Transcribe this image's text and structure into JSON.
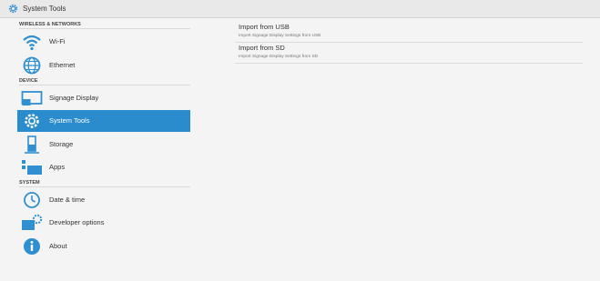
{
  "window": {
    "title": "System Tools",
    "title_icon": "gear-icon"
  },
  "sidebar": {
    "sections": [
      {
        "header": "WIRELESS & NETWORKS",
        "items": [
          {
            "label": "Wi-Fi",
            "icon": "wifi-icon"
          },
          {
            "label": "Ethernet",
            "icon": "ethernet-icon"
          }
        ]
      },
      {
        "header": "DEVICE",
        "items": [
          {
            "label": "Signage Display",
            "icon": "display-icon"
          },
          {
            "label": "System Tools",
            "icon": "gear-icon",
            "selected": true
          },
          {
            "label": "Storage",
            "icon": "storage-icon"
          },
          {
            "label": "Apps",
            "icon": "apps-icon"
          }
        ]
      },
      {
        "header": "SYSTEM",
        "items": [
          {
            "label": "Date & time",
            "icon": "clock-icon"
          },
          {
            "label": "Developer options",
            "icon": "developer-options-icon"
          },
          {
            "label": "About",
            "icon": "info-icon"
          }
        ]
      }
    ]
  },
  "main": {
    "entries": [
      {
        "title": "Import from USB",
        "subtitle": "Import Signage Display Settings from USB"
      },
      {
        "title": "Import from SD",
        "subtitle": "Import Signage Display Settings from SD"
      }
    ]
  },
  "colors": {
    "accent": "#2b8ccd",
    "icon_blue": "#2f8fd0",
    "background": "#f4f4f4"
  }
}
